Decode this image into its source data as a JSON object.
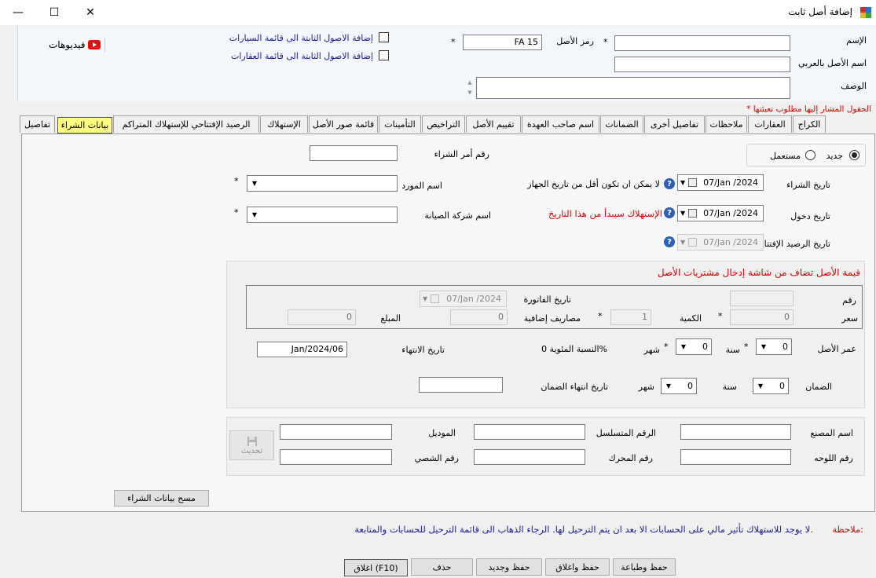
{
  "window": {
    "title": "إضافة أصل ثابت",
    "minimize": "—",
    "maximize": "☐",
    "close": "✕"
  },
  "header": {
    "name_label": "الإسم",
    "asset_code_label": "رمز الأصل",
    "asset_code_value": "FA 15",
    "arabic_name_label": "اسم الأصل بالعربي",
    "description_label": "الوصف",
    "add_to_cars": "إضافة الاصول الثابتة الى قائمة السيارات",
    "add_to_realestate": "إضافة الاصول الثابتة الى قائمة العقارات",
    "videos": "فيديوهات",
    "required_note": "الحقول المشار إليها مطلوب تعبئتها",
    "star": "*"
  },
  "tabs": [
    "الكراج",
    "العقارات",
    "ملاحظات",
    "تفاصيل أخرى",
    "الضمانات",
    "اسم صاحب العهدة",
    "تقييم الأصل",
    "التراخيص",
    "التأمينات",
    "قائمة صور الأصل",
    "الإستهلاك",
    "الرصيد الإفتتاحي للإستهلاك المتراكم",
    "بيانات الشراء",
    "تفاصيل"
  ],
  "purchase": {
    "new_label": "جديد",
    "used_label": "مستعمل",
    "po_number_label": "رقم أمر الشراء",
    "purchase_date_label": "تاريخ الشراء",
    "purchase_date_value": "07/Jan /2024",
    "purchase_date_note": "لا يمكن ان تكون أقل من تاريخ الجهاز",
    "supplier_label": "اسم المورد",
    "entry_date_label": "تاريخ دخول",
    "entry_date_value": "07/Jan /2024",
    "entry_date_note": "الإستهلاك سيبدأ من هذا التاريخ",
    "maintenance_label": "اسم شركة الصيانة",
    "opening_date_label": "تاريخ الرصيد الإفتتاحي",
    "opening_date_value": "07/Jan /2024",
    "value_note": "قيمة الأصل تضاف من شاشة إدخال مشتريات الأصل",
    "number_label": "رقم",
    "invoice_date_label": "تاريخ الفاتورة",
    "invoice_date_value": "07/Jan /2024",
    "price_label": "سعر",
    "price_value": "0",
    "qty_label": "الكمية",
    "qty_value": "1",
    "extra_label": "مصاريف إضافية",
    "extra_value": "0",
    "amount_label": "المبلغ",
    "amount_value": "0",
    "life_label": "عمر الأصل",
    "year_label": "سنة",
    "month_label": "شهر",
    "life_years": "0",
    "life_months": "0",
    "percent_label": "النسبة المئوية 0%",
    "end_date_label": "تاريخ الانتهاء",
    "end_date_value": "Jan/2024/06",
    "warranty_label": "الضمان",
    "warranty_years": "0",
    "warranty_months": "0",
    "warranty_end_label": "تاريخ انتهاء الضمان",
    "manufacturer_label": "اسم المصنع",
    "serial_label": "الرقم المتسلسل",
    "model_label": "الموديل",
    "plate_label": "رقم اللوحه",
    "engine_label": "رقم المحرك",
    "chassis_label": "رقم الشصي",
    "update_button": "تحديث",
    "clear_button": "مسح بيانات الشراء"
  },
  "footer": {
    "note_label": "ملاحظة:",
    "note_text": "لا يوجد للاستهلاك تأثير مالي على الحسابات الا بعد ان يتم الترحيل لها. الرجاء الذهاب الى قائمة الترحيل للحسابات والمتابعة.",
    "save_print": "حفظ وطباعة",
    "save_close": "حفظ واغلاق",
    "save_new": "حفظ وجديد",
    "delete": "حذف",
    "close": "اغلاق (F10)"
  }
}
